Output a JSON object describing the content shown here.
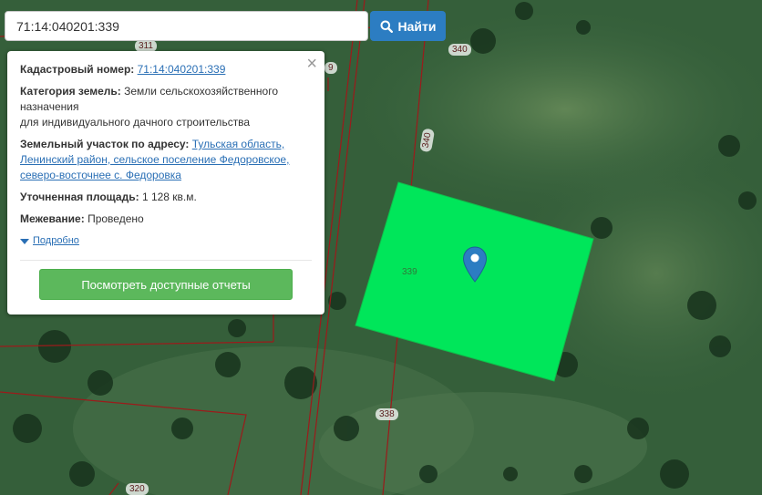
{
  "search": {
    "value": "71:14:040201:339",
    "button_label": "Найти"
  },
  "popup": {
    "cadastral_label": "Кадастровый номер:",
    "cadastral_value": "71:14:040201:339",
    "category_label": "Категория земель:",
    "category_value_1": "Земли сельскохозяйственного назначения",
    "category_value_2": "для индивидуального дачного строительства",
    "address_label": "Земельный участок по адресу:",
    "address_value": "Тульская область, Ленинский район, сельское поселение Федоровское, северо-восточнее с. Федоровка",
    "area_label": "Уточненная площадь:",
    "area_value": "1 128 кв.м.",
    "survey_label": "Межевание:",
    "survey_value": "Проведено",
    "more_label": "Подробно",
    "reports_button": "Посмотреть доступные отчеты"
  },
  "map": {
    "parcel_labels": [
      "311",
      "340",
      "340",
      "339",
      "338",
      "320",
      "9"
    ],
    "highlight_color": "#00e65a",
    "marker_color": "#2c7dc2"
  }
}
